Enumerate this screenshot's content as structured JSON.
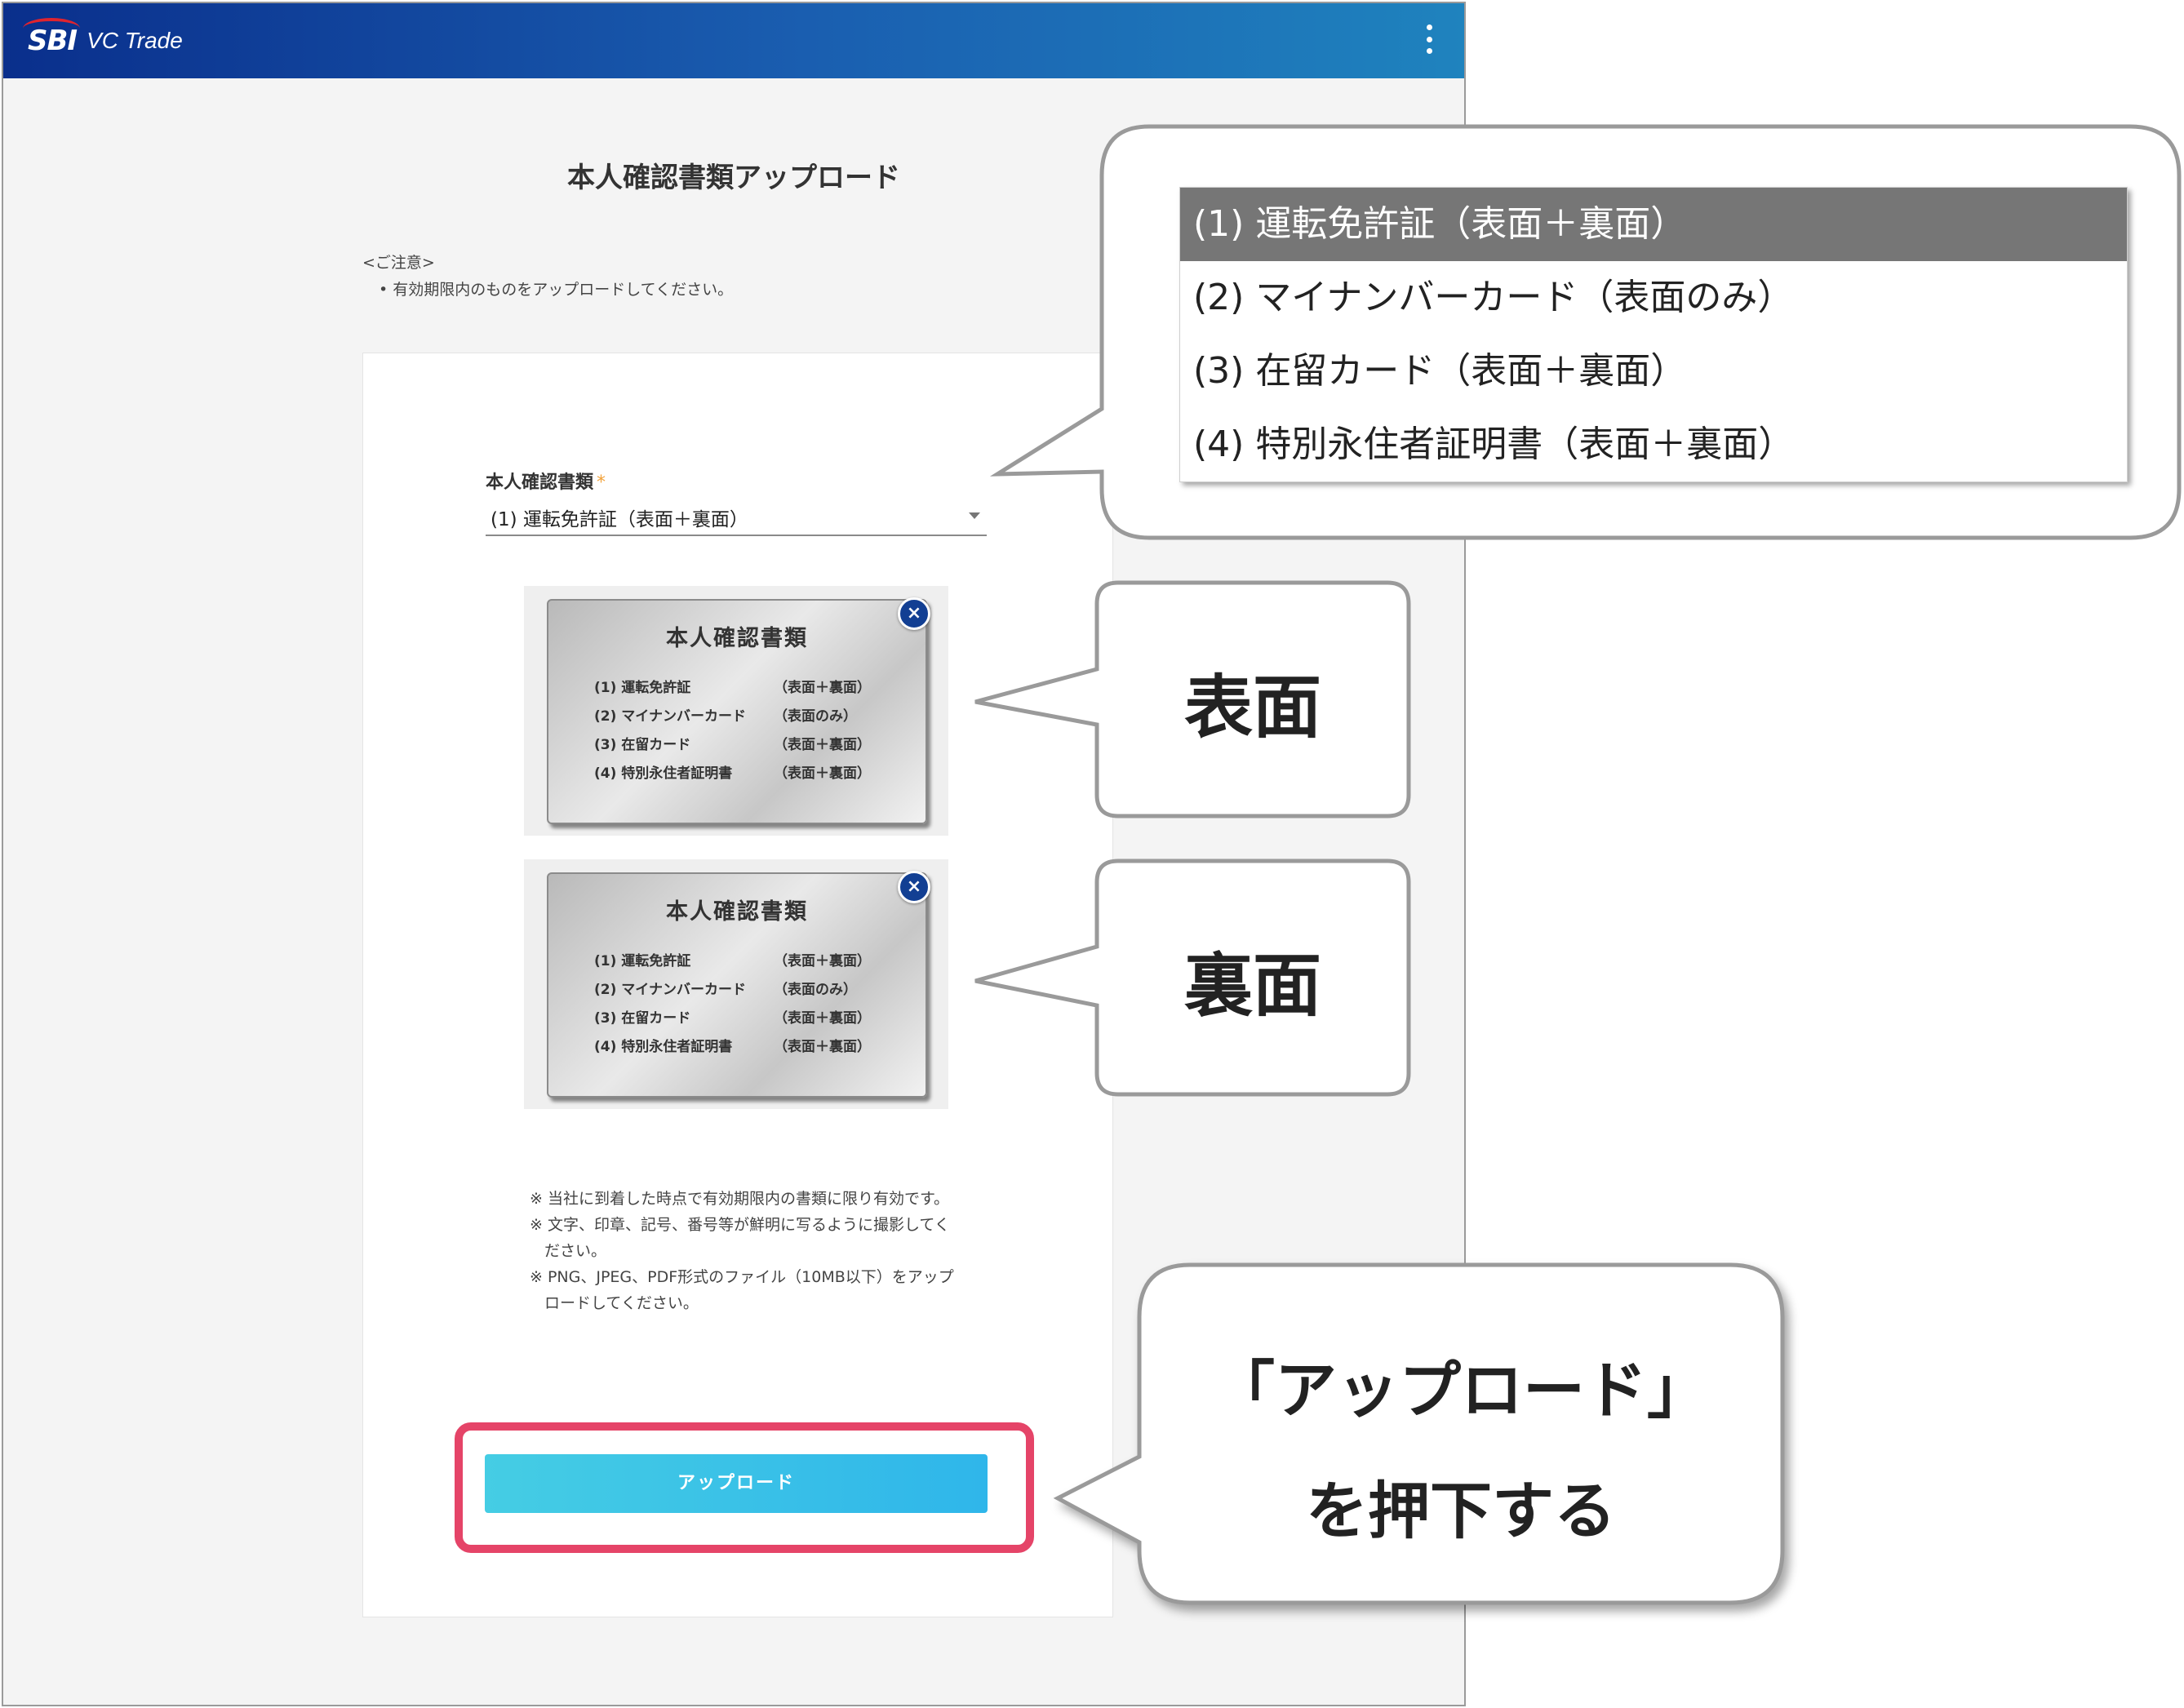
{
  "app": {
    "logo_mark": "SBI",
    "logo_text": "VC Trade",
    "menu_icon": "kebab-menu-icon"
  },
  "page": {
    "title": "本人確認書類アップロード",
    "notice_heading": "<ご注意>",
    "notice_item": "• 有効期限内のものをアップロードしてください。"
  },
  "form": {
    "field_label": "本人確認書類",
    "required_mark": "*",
    "selected_value": "(1) 運転免許証（表面＋裏面）",
    "documents": [
      {
        "title": "本人確認書類",
        "rows": [
          {
            "left": "(1) 運転免許証",
            "right": "（表面＋裏面）"
          },
          {
            "left": "(2) マイナンバーカード",
            "right": "（表面のみ）"
          },
          {
            "left": "(3) 在留カード",
            "right": "（表面＋裏面）"
          },
          {
            "left": "(4) 特別永住者証明書",
            "right": "（表面＋裏面）"
          }
        ],
        "close_label": "×"
      },
      {
        "title": "本人確認書類",
        "rows": [
          {
            "left": "(1) 運転免許証",
            "right": "（表面＋裏面）"
          },
          {
            "left": "(2) マイナンバーカード",
            "right": "（表面のみ）"
          },
          {
            "left": "(3) 在留カード",
            "right": "（表面＋裏面）"
          },
          {
            "left": "(4) 特別永住者証明書",
            "right": "（表面＋裏面）"
          }
        ],
        "close_label": "×"
      }
    ],
    "notes": [
      "※ 当社に到着した時点で有効期限内の書類に限り有効です。",
      "※ 文字、印章、記号、番号等が鮮明に写るように撮影してください。",
      "※ PNG、JPEG、PDF形式のファイル（10MB以下）をアップロードしてください。"
    ],
    "upload_button": "アップロード"
  },
  "dropdown": {
    "options": [
      "(1) 運転免許証（表面＋裏面）",
      "(2) マイナンバーカード（表面のみ）",
      "(3) 在留カード（表面＋裏面）",
      "(4) 特別永住者証明書（表面＋裏面）"
    ],
    "selected_index": 0
  },
  "callouts": {
    "front": "表面",
    "back": "裏面",
    "upload_line1": "「アップロード」",
    "upload_line2": "を押下する"
  },
  "colors": {
    "appbar_start": "#0a2f8c",
    "appbar_end": "#1f83be",
    "upload_button": "#3cc3e7",
    "highlight_outline": "#e54468",
    "close_button": "#123f93",
    "required": "#f2a23b"
  }
}
